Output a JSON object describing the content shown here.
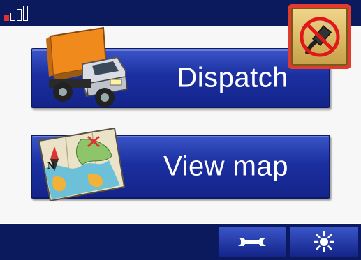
{
  "status": {
    "signal_bars_total": 4,
    "signal_bars_filled": 1,
    "colors": {
      "signal_active": "#e0322b",
      "alert_frame": "#e23b2e",
      "bar_background": "#0b1a5c",
      "button_blue": "#1b2fa0"
    }
  },
  "menu": {
    "dispatch_label": "Dispatch",
    "view_map_label": "View map",
    "dispatch_icon": "delivery-truck-icon",
    "view_map_icon": "folded-map-icon"
  },
  "top_right": {
    "icon": "no-external-power-icon"
  },
  "toolbar": {
    "settings_icon": "wrench-icon",
    "brightness_icon": "sun-icon"
  }
}
